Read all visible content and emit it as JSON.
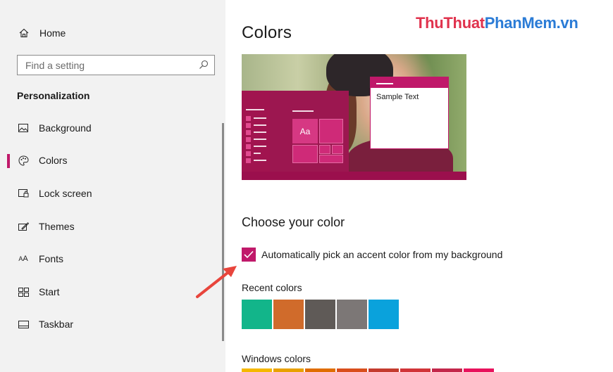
{
  "sidebar": {
    "home_label": "Home",
    "search_placeholder": "Find a setting",
    "section_title": "Personalization",
    "items": [
      {
        "label": "Background",
        "icon": "image-icon"
      },
      {
        "label": "Colors",
        "icon": "palette-icon",
        "active": true
      },
      {
        "label": "Lock screen",
        "icon": "lock-screen-icon"
      },
      {
        "label": "Themes",
        "icon": "themes-icon"
      },
      {
        "label": "Fonts",
        "icon": "fonts-icon"
      },
      {
        "label": "Start",
        "icon": "start-icon"
      },
      {
        "label": "Taskbar",
        "icon": "taskbar-icon"
      }
    ]
  },
  "main": {
    "title": "Colors",
    "watermark_a": "ThuThuat",
    "watermark_b": "PhanMem.vn",
    "preview_sample_text": "Sample Text",
    "preview_tile_text": "Aa",
    "choose_title": "Choose your color",
    "auto_accent_label": "Automatically pick an accent color from my background",
    "auto_accent_checked": true,
    "recent_colors_label": "Recent colors",
    "recent_colors": [
      "#12b58a",
      "#d06b2b",
      "#5f5a57",
      "#7c7776",
      "#0aa2dc"
    ],
    "windows_colors_label": "Windows colors",
    "windows_colors": [
      "#f5b800",
      "#e8a100",
      "#e06d00",
      "#d94e1c",
      "#c43b2e",
      "#d13438",
      "#c3274a",
      "#e8125c"
    ]
  },
  "colors": {
    "accent": "#c0196a",
    "sidebar_bg": "#f2f2f2",
    "arrow": "#e8453c"
  }
}
